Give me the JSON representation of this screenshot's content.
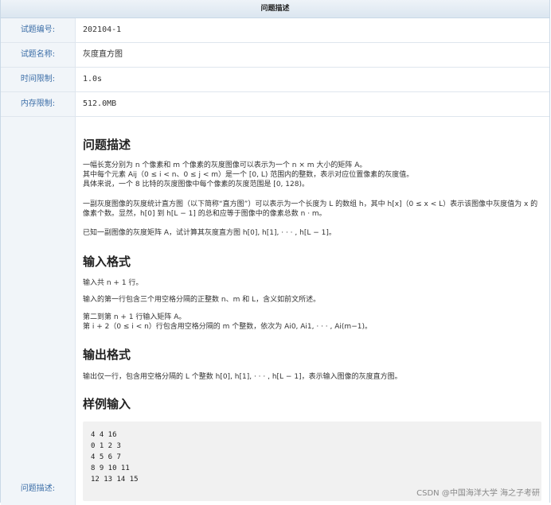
{
  "header": {
    "title": "问题描述"
  },
  "info": [
    {
      "label": "试题编号:",
      "value": "202104-1"
    },
    {
      "label": "试题名称:",
      "value": "灰度直方图"
    },
    {
      "label": "时间限制:",
      "value": "1.0s"
    },
    {
      "label": "内存限制:",
      "value": "512.0MB"
    }
  ],
  "desc_label": "问题描述:",
  "sections": {
    "problem": {
      "title": "问题描述",
      "p1": "一幅长宽分别为 n 个像素和 m 个像素的灰度图像可以表示为一个 n × m 大小的矩阵 A。",
      "p2": "其中每个元素 Aij（0 ≤ i < n、0 ≤ j < m）是一个 [0, L) 范围内的整数，表示对应位置像素的灰度值。",
      "p3": "具体来说，一个 8 比特的灰度图像中每个像素的灰度范围是 [0, 128)。",
      "p4": "一副灰度图像的灰度统计直方图（以下简称“直方图”）可以表示为一个长度为 L 的数组 h，其中 h[x]（0 ≤ x < L）表示该图像中灰度值为 x 的像素个数。显然，h[0] 到 h[L − 1] 的总和应等于图像中的像素总数 n · m。",
      "p5": "已知一副图像的灰度矩阵 A，试计算其灰度直方图 h[0], h[1], · · · , h[L − 1]。"
    },
    "input": {
      "title": "输入格式",
      "p1": "输入共 n + 1 行。",
      "p2": "输入的第一行包含三个用空格分隔的正整数 n、m 和 L，含义如前文所述。",
      "p3": "第二到第 n + 1 行输入矩阵 A。",
      "p4": "第 i + 2（0 ≤ i < n）行包含用空格分隔的 m 个整数，依次为 Ai0, Ai1, · · · , Ai(m−1)。"
    },
    "output": {
      "title": "输出格式",
      "p1": "输出仅一行，包含用空格分隔的 L 个整数 h[0], h[1], · · · , h[L − 1]，表示输入图像的灰度直方图。"
    },
    "sample": {
      "title": "样例输入",
      "lines": [
        "4 4 16",
        "0 1 2 3",
        "4 5 6 7",
        "8 9 10 11",
        "12 13 14 15"
      ]
    }
  },
  "watermark": "CSDN @中国海洋大学 海之子考研"
}
